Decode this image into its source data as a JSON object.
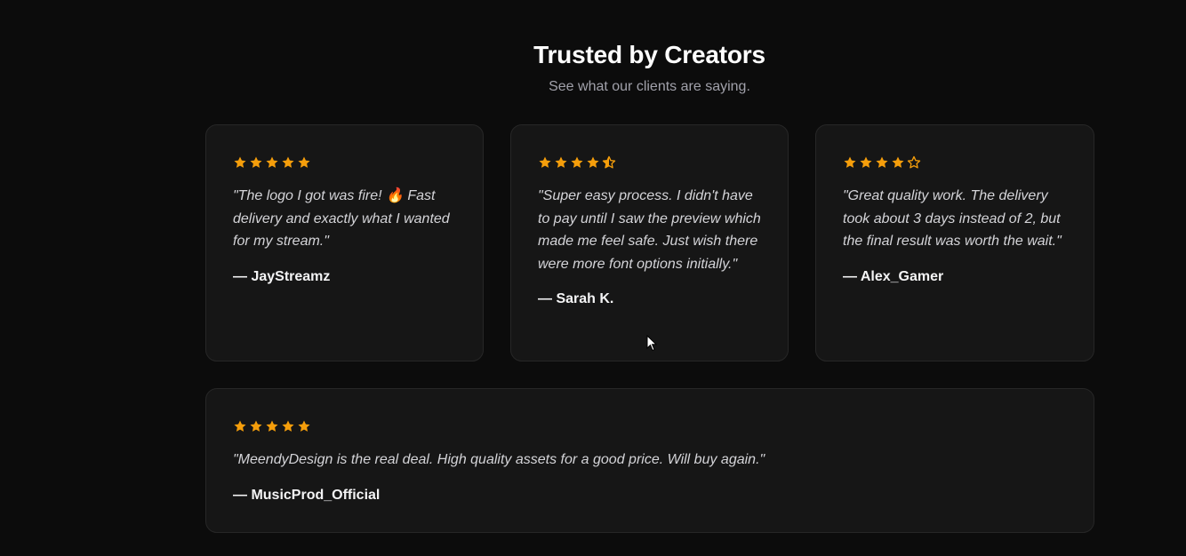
{
  "header": {
    "title": "Trusted by Creators",
    "subtitle": "See what our clients are saying."
  },
  "colors": {
    "star": "#f59e0b",
    "background": "#0c0c0c",
    "card": "#161616"
  },
  "testimonials": [
    {
      "rating": 5,
      "stars": [
        "full",
        "full",
        "full",
        "full",
        "full"
      ],
      "quote": "\"The logo I got was fire! 🔥 Fast delivery and exactly what I wanted for my stream.\"",
      "author": "— JayStreamz"
    },
    {
      "rating": 4.5,
      "stars": [
        "full",
        "full",
        "full",
        "full",
        "half"
      ],
      "quote": "\"Super easy process. I didn't have to pay until I saw the preview which made me feel safe. Just wish there were more font options initially.\"",
      "author": "— Sarah K."
    },
    {
      "rating": 4,
      "stars": [
        "full",
        "full",
        "full",
        "full",
        "empty"
      ],
      "quote": "\"Great quality work. The delivery took about 3 days instead of 2, but the final result was worth the wait.\"",
      "author": "— Alex_Gamer"
    },
    {
      "rating": 5,
      "stars": [
        "full",
        "full",
        "full",
        "full",
        "full"
      ],
      "quote": "\"MeendyDesign is the real deal. High quality assets for a good price. Will buy again.\"",
      "author": "— MusicProd_Official"
    }
  ]
}
